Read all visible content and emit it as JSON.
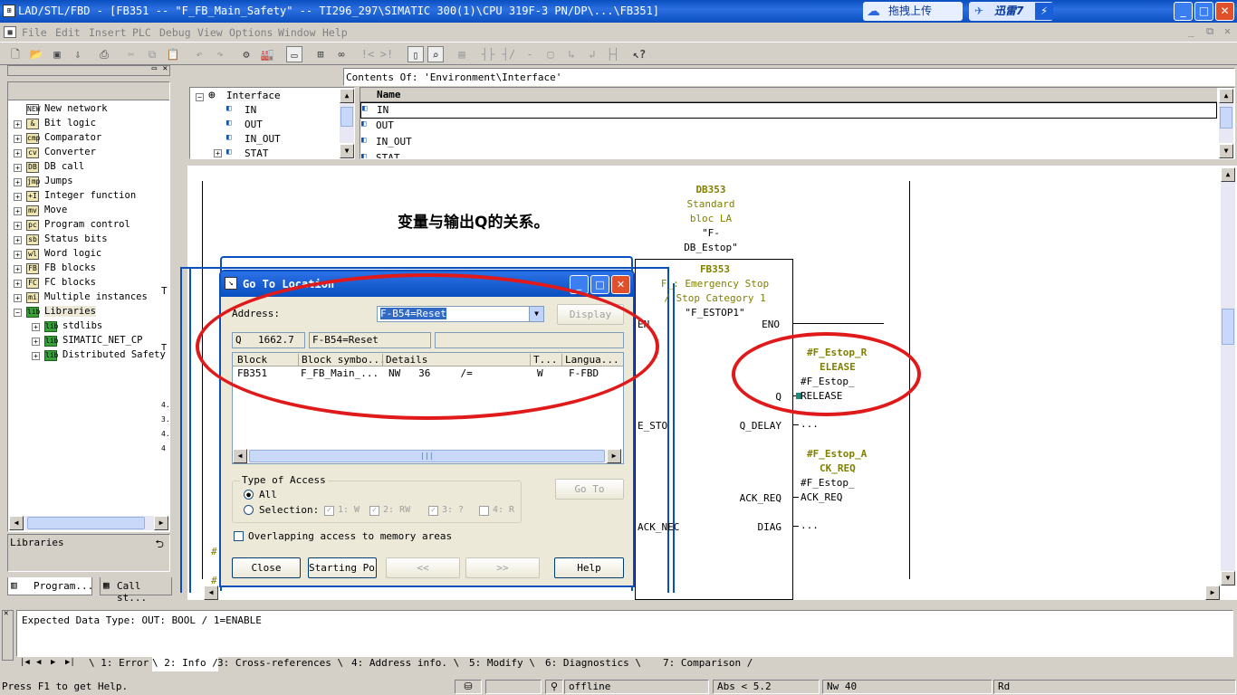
{
  "window": {
    "title": "LAD/STL/FBD  - [FB351 -- \"F_FB_Main_Safety\" -- TI296_297\\SIMATIC 300(1)\\CPU 319F-3 PN/DP\\...\\FB351]",
    "cloud_badge": "拖拽上传",
    "xunlei_badge": "迅雷7",
    "buttons": {
      "minimize": "_",
      "maximize": "□",
      "close": "✕"
    }
  },
  "menu": [
    "File",
    "Edit",
    "Insert",
    "PLC",
    "Debug",
    "View",
    "Options",
    "Window",
    "Help"
  ],
  "left_panel": {
    "tree": [
      {
        "label": "New network",
        "icon": "NEW"
      },
      {
        "label": "Bit logic",
        "icon": "&"
      },
      {
        "label": "Comparator",
        "icon": "cmp"
      },
      {
        "label": "Converter",
        "icon": "cv"
      },
      {
        "label": "DB call",
        "icon": "DB"
      },
      {
        "label": "Jumps",
        "icon": "jmp"
      },
      {
        "label": "Integer function",
        "icon": "+I"
      },
      {
        "label": "Move",
        "icon": "mv"
      },
      {
        "label": "Program control",
        "icon": "pc"
      },
      {
        "label": "Status bits",
        "icon": "sb"
      },
      {
        "label": "Word logic",
        "icon": "wl"
      },
      {
        "label": "FB blocks",
        "icon": "FB"
      },
      {
        "label": "FC blocks",
        "icon": "FC"
      },
      {
        "label": "Multiple instances",
        "icon": "mi"
      },
      {
        "label": "Libraries",
        "icon": "lib"
      },
      {
        "label": "stdlibs",
        "icon": "lib"
      },
      {
        "label": "SIMATIC_NET_CP",
        "icon": "lib"
      },
      {
        "label": "Distributed Safety",
        "icon": "lib"
      }
    ],
    "info_label": "Libraries",
    "tabs": [
      "Program...",
      "Call st..."
    ]
  },
  "interface_panel": {
    "header": "Contents Of: 'Environment\\Interface'",
    "tree_root": "Interface",
    "tree_items": [
      "IN",
      "OUT",
      "IN_OUT",
      "STAT"
    ],
    "column": "Name",
    "rows": [
      "IN",
      "OUT",
      "IN_OUT",
      "STAT"
    ]
  },
  "editor": {
    "heading": "变量与输出Q的关系。",
    "db_lines": [
      "DB353",
      "Standard",
      "bloc LA",
      "\"F-",
      "DB_Estop\""
    ],
    "fb_lines": [
      "FB353",
      "F_: Emergency Stop",
      "/ Stop Category 1",
      "\"F_ESTOP1\""
    ],
    "en": "EN",
    "eno": "ENO",
    "pins_left": [
      "E_STO",
      "ACK_NEC"
    ],
    "pins_right": [
      "Q",
      "Q_DELAY",
      "ACK_REQ",
      "DIAG"
    ],
    "release_label": [
      "#F_Estop_R",
      "ELEASE"
    ],
    "release_var": [
      "#F_Estop_",
      "RELEASE"
    ],
    "qdelay_out": "...",
    "ackreq_label": [
      "#F_Estop_A",
      "CK_REQ"
    ],
    "ackreq_var": [
      "#F_Estop_",
      "ACK_REQ"
    ],
    "diag_out": "...",
    "side_marks": [
      "T",
      "T",
      "4.",
      "3.",
      "4.",
      "4",
      "#",
      "#"
    ]
  },
  "dialog": {
    "title": "Go To Location",
    "address_label": "Address:",
    "address_value": "F-B54=Reset",
    "display_button": "Display",
    "op_field": "Q",
    "addr_field": "1662.7",
    "sym_field": "F-B54=Reset",
    "columns": [
      "Block",
      "Block symbo...",
      "Details",
      "T...",
      "Langua..."
    ],
    "rows": [
      {
        "block": "FB351",
        "symbol": "F_FB_Main_...",
        "details": "NW   36     /=",
        "type": "W",
        "lang": "F-FBD"
      }
    ],
    "access_group": "Type of Access",
    "all": "All",
    "selection": "Selection:",
    "sel_options": [
      "1: W",
      "2: RW",
      "3: ?",
      "4: R"
    ],
    "goto_button": "Go To",
    "overlap": "Overlapping access to memory areas",
    "buttons": [
      "Close",
      "Starting Poin",
      "<<",
      ">>",
      "Help"
    ]
  },
  "output": {
    "message": "Expected Data Type: OUT: BOOL / 1=ENABLE",
    "tabs": [
      "1: Error",
      "2: Info",
      "3: Cross-references",
      "4: Address info.",
      "5: Modify",
      "6: Diagnostics",
      "7: Comparison"
    ]
  },
  "statusbar": {
    "help": "Press F1 to get Help.",
    "mode": "offline",
    "abs": "Abs < 5.2",
    "nw": "Nw 40",
    "rd": "Rd"
  }
}
